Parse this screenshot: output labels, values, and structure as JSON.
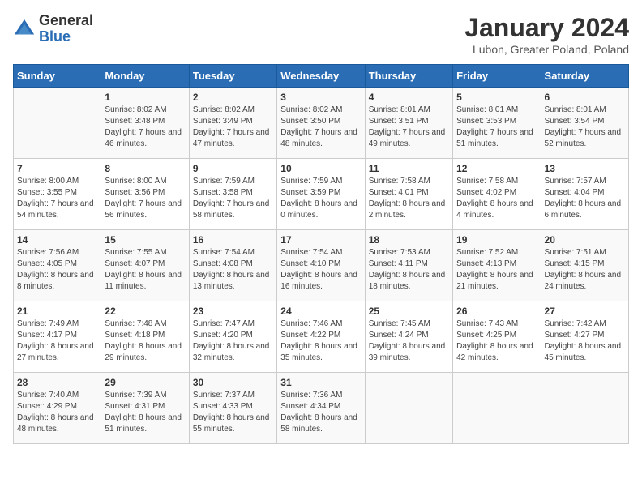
{
  "header": {
    "logo": {
      "general": "General",
      "blue": "Blue"
    },
    "title": "January 2024",
    "subtitle": "Lubon, Greater Poland, Poland"
  },
  "weekdays": [
    "Sunday",
    "Monday",
    "Tuesday",
    "Wednesday",
    "Thursday",
    "Friday",
    "Saturday"
  ],
  "weeks": [
    [
      {
        "day": "",
        "sunrise": "",
        "sunset": "",
        "daylight": ""
      },
      {
        "day": "1",
        "sunrise": "Sunrise: 8:02 AM",
        "sunset": "Sunset: 3:48 PM",
        "daylight": "Daylight: 7 hours and 46 minutes."
      },
      {
        "day": "2",
        "sunrise": "Sunrise: 8:02 AM",
        "sunset": "Sunset: 3:49 PM",
        "daylight": "Daylight: 7 hours and 47 minutes."
      },
      {
        "day": "3",
        "sunrise": "Sunrise: 8:02 AM",
        "sunset": "Sunset: 3:50 PM",
        "daylight": "Daylight: 7 hours and 48 minutes."
      },
      {
        "day": "4",
        "sunrise": "Sunrise: 8:01 AM",
        "sunset": "Sunset: 3:51 PM",
        "daylight": "Daylight: 7 hours and 49 minutes."
      },
      {
        "day": "5",
        "sunrise": "Sunrise: 8:01 AM",
        "sunset": "Sunset: 3:53 PM",
        "daylight": "Daylight: 7 hours and 51 minutes."
      },
      {
        "day": "6",
        "sunrise": "Sunrise: 8:01 AM",
        "sunset": "Sunset: 3:54 PM",
        "daylight": "Daylight: 7 hours and 52 minutes."
      }
    ],
    [
      {
        "day": "7",
        "sunrise": "Sunrise: 8:00 AM",
        "sunset": "Sunset: 3:55 PM",
        "daylight": "Daylight: 7 hours and 54 minutes."
      },
      {
        "day": "8",
        "sunrise": "Sunrise: 8:00 AM",
        "sunset": "Sunset: 3:56 PM",
        "daylight": "Daylight: 7 hours and 56 minutes."
      },
      {
        "day": "9",
        "sunrise": "Sunrise: 7:59 AM",
        "sunset": "Sunset: 3:58 PM",
        "daylight": "Daylight: 7 hours and 58 minutes."
      },
      {
        "day": "10",
        "sunrise": "Sunrise: 7:59 AM",
        "sunset": "Sunset: 3:59 PM",
        "daylight": "Daylight: 8 hours and 0 minutes."
      },
      {
        "day": "11",
        "sunrise": "Sunrise: 7:58 AM",
        "sunset": "Sunset: 4:01 PM",
        "daylight": "Daylight: 8 hours and 2 minutes."
      },
      {
        "day": "12",
        "sunrise": "Sunrise: 7:58 AM",
        "sunset": "Sunset: 4:02 PM",
        "daylight": "Daylight: 8 hours and 4 minutes."
      },
      {
        "day": "13",
        "sunrise": "Sunrise: 7:57 AM",
        "sunset": "Sunset: 4:04 PM",
        "daylight": "Daylight: 8 hours and 6 minutes."
      }
    ],
    [
      {
        "day": "14",
        "sunrise": "Sunrise: 7:56 AM",
        "sunset": "Sunset: 4:05 PM",
        "daylight": "Daylight: 8 hours and 8 minutes."
      },
      {
        "day": "15",
        "sunrise": "Sunrise: 7:55 AM",
        "sunset": "Sunset: 4:07 PM",
        "daylight": "Daylight: 8 hours and 11 minutes."
      },
      {
        "day": "16",
        "sunrise": "Sunrise: 7:54 AM",
        "sunset": "Sunset: 4:08 PM",
        "daylight": "Daylight: 8 hours and 13 minutes."
      },
      {
        "day": "17",
        "sunrise": "Sunrise: 7:54 AM",
        "sunset": "Sunset: 4:10 PM",
        "daylight": "Daylight: 8 hours and 16 minutes."
      },
      {
        "day": "18",
        "sunrise": "Sunrise: 7:53 AM",
        "sunset": "Sunset: 4:11 PM",
        "daylight": "Daylight: 8 hours and 18 minutes."
      },
      {
        "day": "19",
        "sunrise": "Sunrise: 7:52 AM",
        "sunset": "Sunset: 4:13 PM",
        "daylight": "Daylight: 8 hours and 21 minutes."
      },
      {
        "day": "20",
        "sunrise": "Sunrise: 7:51 AM",
        "sunset": "Sunset: 4:15 PM",
        "daylight": "Daylight: 8 hours and 24 minutes."
      }
    ],
    [
      {
        "day": "21",
        "sunrise": "Sunrise: 7:49 AM",
        "sunset": "Sunset: 4:17 PM",
        "daylight": "Daylight: 8 hours and 27 minutes."
      },
      {
        "day": "22",
        "sunrise": "Sunrise: 7:48 AM",
        "sunset": "Sunset: 4:18 PM",
        "daylight": "Daylight: 8 hours and 29 minutes."
      },
      {
        "day": "23",
        "sunrise": "Sunrise: 7:47 AM",
        "sunset": "Sunset: 4:20 PM",
        "daylight": "Daylight: 8 hours and 32 minutes."
      },
      {
        "day": "24",
        "sunrise": "Sunrise: 7:46 AM",
        "sunset": "Sunset: 4:22 PM",
        "daylight": "Daylight: 8 hours and 35 minutes."
      },
      {
        "day": "25",
        "sunrise": "Sunrise: 7:45 AM",
        "sunset": "Sunset: 4:24 PM",
        "daylight": "Daylight: 8 hours and 39 minutes."
      },
      {
        "day": "26",
        "sunrise": "Sunrise: 7:43 AM",
        "sunset": "Sunset: 4:25 PM",
        "daylight": "Daylight: 8 hours and 42 minutes."
      },
      {
        "day": "27",
        "sunrise": "Sunrise: 7:42 AM",
        "sunset": "Sunset: 4:27 PM",
        "daylight": "Daylight: 8 hours and 45 minutes."
      }
    ],
    [
      {
        "day": "28",
        "sunrise": "Sunrise: 7:40 AM",
        "sunset": "Sunset: 4:29 PM",
        "daylight": "Daylight: 8 hours and 48 minutes."
      },
      {
        "day": "29",
        "sunrise": "Sunrise: 7:39 AM",
        "sunset": "Sunset: 4:31 PM",
        "daylight": "Daylight: 8 hours and 51 minutes."
      },
      {
        "day": "30",
        "sunrise": "Sunrise: 7:37 AM",
        "sunset": "Sunset: 4:33 PM",
        "daylight": "Daylight: 8 hours and 55 minutes."
      },
      {
        "day": "31",
        "sunrise": "Sunrise: 7:36 AM",
        "sunset": "Sunset: 4:34 PM",
        "daylight": "Daylight: 8 hours and 58 minutes."
      },
      {
        "day": "",
        "sunrise": "",
        "sunset": "",
        "daylight": ""
      },
      {
        "day": "",
        "sunrise": "",
        "sunset": "",
        "daylight": ""
      },
      {
        "day": "",
        "sunrise": "",
        "sunset": "",
        "daylight": ""
      }
    ]
  ]
}
